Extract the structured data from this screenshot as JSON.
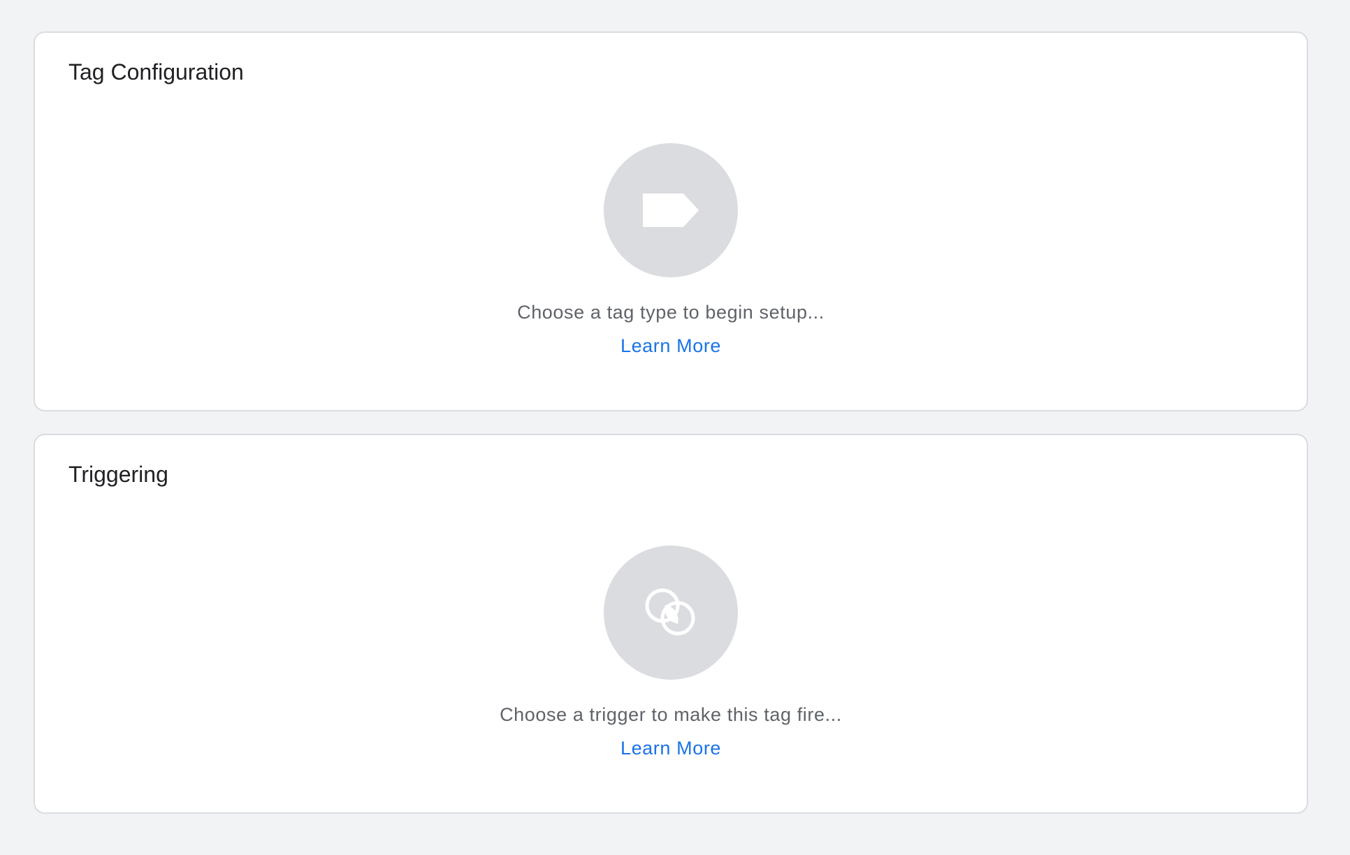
{
  "tag_configuration": {
    "title": "Tag Configuration",
    "icon": "tag-icon",
    "hint": "Choose a tag type to begin setup...",
    "learn_more": "Learn More"
  },
  "triggering": {
    "title": "Triggering",
    "icon": "trigger-icon",
    "hint": "Choose a trigger to make this tag fire...",
    "learn_more": "Learn More"
  },
  "colors": {
    "background": "#f1f3f4",
    "card": "#ffffff",
    "card_border": "#dadce0",
    "icon_circle": "#dadce0",
    "title_text": "#202124",
    "hint_text": "#5f6368",
    "link": "#1a73e8"
  }
}
